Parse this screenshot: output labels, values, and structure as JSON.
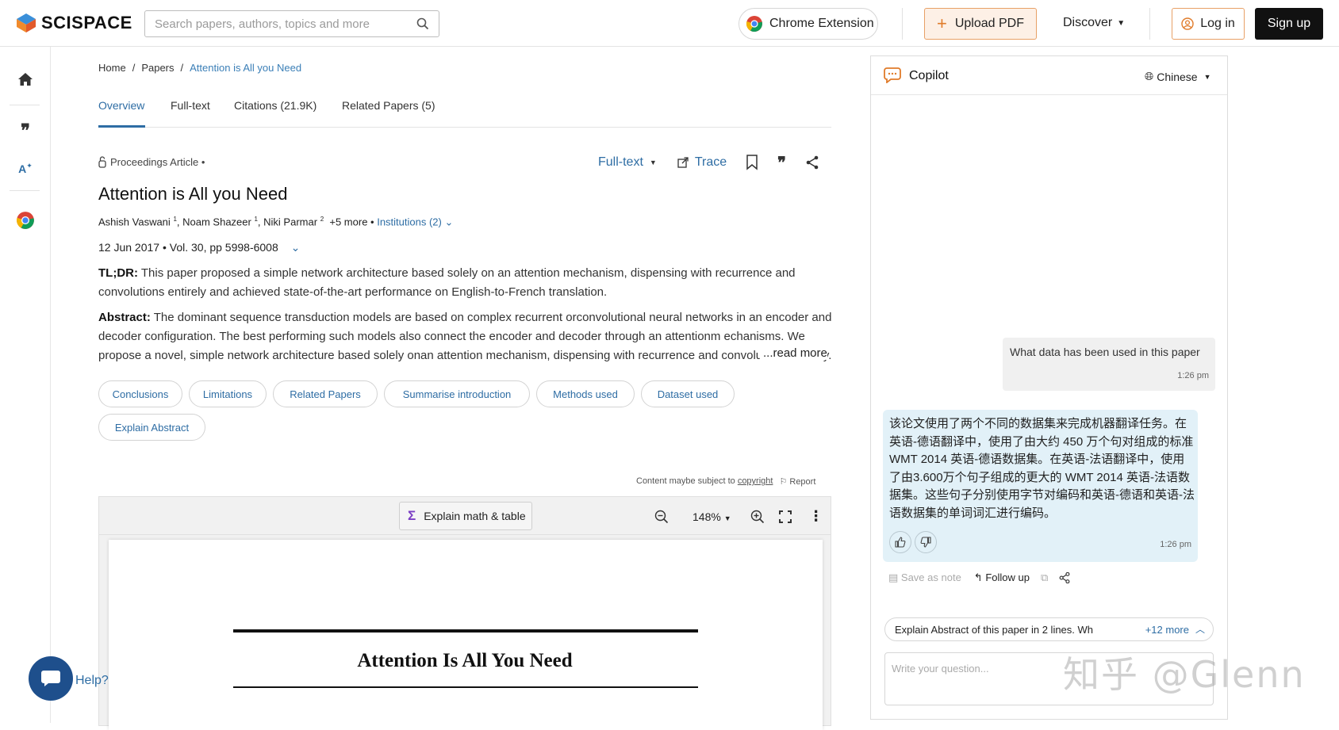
{
  "header": {
    "logo_text": "SCISPACE",
    "search_placeholder": "Search papers, authors, topics and more",
    "chrome_extension": "Chrome Extension",
    "upload_pdf": "Upload PDF",
    "discover": "Discover",
    "log_in": "Log in",
    "sign_up": "Sign up"
  },
  "breadcrumb": [
    "Home",
    "Papers",
    "Attention is All you Need"
  ],
  "tabs": [
    {
      "label": "Overview",
      "active": true
    },
    {
      "label": "Full-text",
      "active": false
    },
    {
      "label": "Citations (21.9K)",
      "active": false
    },
    {
      "label": "Related Papers (5)",
      "active": false
    }
  ],
  "paper": {
    "type": "Proceedings Article •",
    "actions": {
      "fulltext": "Full-text",
      "trace": "Trace"
    },
    "title": "Attention is All you Need",
    "authors": [
      {
        "name": "Ashish Vaswani",
        "sup": "1"
      },
      {
        "name": "Noam Shazeer",
        "sup": "1"
      },
      {
        "name": "Niki Parmar",
        "sup": "2"
      }
    ],
    "more_authors": "+5 more •",
    "institutions": "Institutions (2)",
    "meta": "12 Jun 2017 • Vol. 30, pp 5998-6008",
    "tldr_label": "TL;DR:",
    "tldr": "This paper proposed a simple network architecture based solely on an attention mechanism, dispensing with recurrence and convolutions entirely and achieved state-of-the-art performance on English-to-French translation.",
    "abstract_label": "Abstract:",
    "abstract": "The dominant sequence transduction models are based on complex recurrent orconvolutional neural networks in an encoder and decoder configuration. The best performing such models also connect the encoder and decoder through an attentionm echanisms. We propose a novel, simple network architecture based solely onan attention mechanism, dispensing with recurrence and convolutions entirely.",
    "read_more": "...read more"
  },
  "chips": [
    "Conclusions",
    "Limitations",
    "Related Papers",
    "Summarise introduction",
    "Methods used",
    "Dataset used",
    "Explain Abstract"
  ],
  "content_note": {
    "text": "Content maybe subject to",
    "link": "copyright",
    "report": "Report"
  },
  "viewer": {
    "explain": "Explain math & table",
    "zoom": "148%",
    "pdf_title": "Attention Is All You Need"
  },
  "help": {
    "label": "Help?"
  },
  "copilot": {
    "title": "Copilot",
    "language": "Chinese",
    "user_message": "What data has been used in this paper",
    "user_time": "1:26 pm",
    "bot_message": "该论文使用了两个不同的数据集来完成机器翻译任务。在英语-德语翻译中，使用了由大约 450 万个句对组成的标准 WMT 2014 英语-德语数据集。在英语-法语翻译中，使用了由3.600万个句子组成的更大的 WMT 2014 英语-法语数据集。这些句子分别使用字节对编码和英语-德语和英语-法语数据集的单词词汇进行编码。",
    "bot_time": "1:26 pm",
    "save_note": "Save as note",
    "follow_up": "Follow up",
    "suggestion": "Explain Abstract of this paper in 2 lines. Wh",
    "suggestion_more": "+12 more",
    "question_placeholder": "Write your question..."
  },
  "watermark": "知乎 @Glenn",
  "colors": {
    "accent": "#2e6da4",
    "brand_orange": "#e07b2a",
    "bot_bubble": "#e2f1f8"
  }
}
